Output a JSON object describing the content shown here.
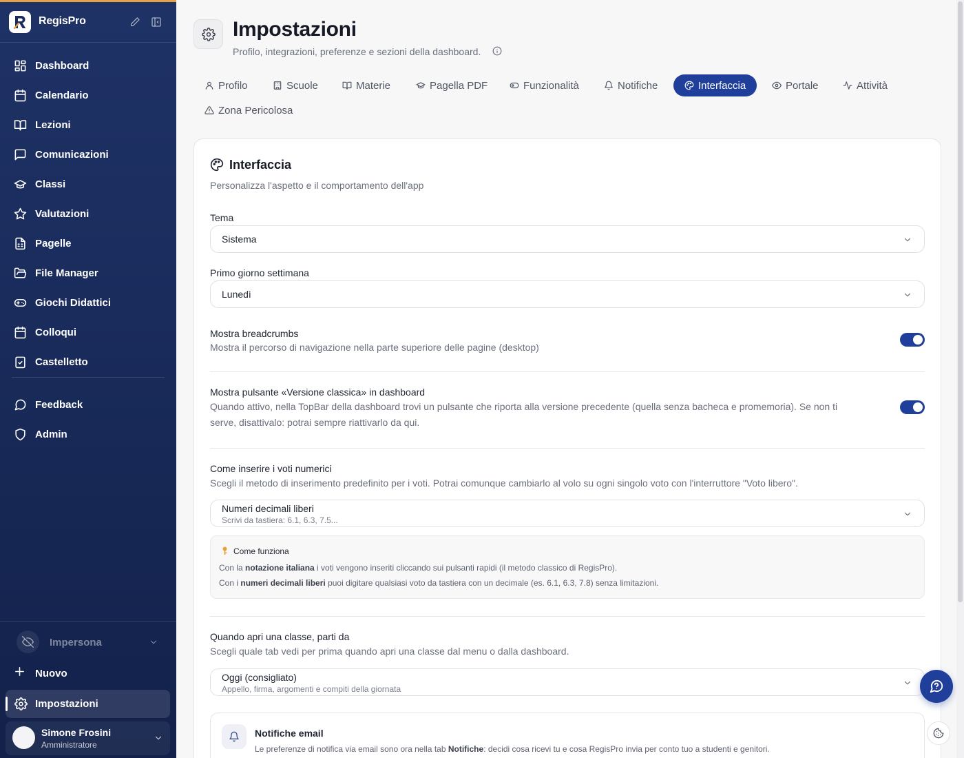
{
  "sidebar": {
    "brand": {
      "name": "RegisPro",
      "logo_letter": "R"
    },
    "items": [
      {
        "label": "Dashboard",
        "icon": "dashboard-grid-icon"
      },
      {
        "label": "Calendario",
        "icon": "calendar-icon"
      },
      {
        "label": "Lezioni",
        "icon": "book-open-icon"
      },
      {
        "label": "Comunicazioni",
        "icon": "message-square-icon"
      },
      {
        "label": "Classi",
        "icon": "graduation-cap-icon"
      },
      {
        "label": "Valutazioni",
        "icon": "star-icon"
      },
      {
        "label": "Pagelle",
        "icon": "report-card-icon"
      },
      {
        "label": "File Manager",
        "icon": "folder-icon"
      },
      {
        "label": "Giochi Didattici",
        "icon": "gamepad-icon"
      },
      {
        "label": "Colloqui",
        "icon": "calendar-check-icon"
      },
      {
        "label": "Castelletto",
        "icon": "clipboard-check-icon"
      }
    ],
    "secondary_items": [
      {
        "label": "Feedback",
        "icon": "message-circle-icon"
      },
      {
        "label": "Admin",
        "icon": "shield-icon"
      }
    ],
    "impersona_label": "Impersona",
    "nuovo_label": "Nuovo",
    "settings_label": "Impostazioni",
    "user": {
      "name": "Simone Frosini",
      "role": "Amministratore"
    }
  },
  "header": {
    "title": "Impostazioni",
    "subtitle": "Profilo, integrazioni, preferenze e sezioni della dashboard."
  },
  "tabs": [
    {
      "label": "Profilo",
      "active": false
    },
    {
      "label": "Scuole",
      "active": false
    },
    {
      "label": "Materie",
      "active": false
    },
    {
      "label": "Pagella PDF",
      "active": false
    },
    {
      "label": "Funzionalità",
      "active": false
    },
    {
      "label": "Notifiche",
      "active": false
    },
    {
      "label": "Interfaccia",
      "active": true
    },
    {
      "label": "Portale",
      "active": false
    },
    {
      "label": "Attività",
      "active": false
    },
    {
      "label": "Zona Pericolosa",
      "active": false
    }
  ],
  "interfaccia": {
    "title": "Interfaccia",
    "subtitle": "Personalizza l'aspetto e il comportamento dell'app",
    "tema": {
      "label": "Tema",
      "value": "Sistema"
    },
    "primo_giorno": {
      "label": "Primo giorno settimana",
      "value": "Lunedì"
    },
    "breadcrumbs": {
      "title": "Mostra breadcrumbs",
      "desc": "Mostra il percorso di navigazione nella parte superiore delle pagine (desktop)",
      "enabled": true
    },
    "versione_classica": {
      "title": "Mostra pulsante «Versione classica» in dashboard",
      "desc_line1": "Quando attivo, nella TopBar della dashboard trovi un pulsante che riporta alla versione precedente (quella senza bacheca e promemoria). Se non ti",
      "desc_line2": "serve, disattivalo: potrai sempre riattivarlo da qui.",
      "enabled": true
    },
    "voti": {
      "title": "Come inserire i voti numerici",
      "desc": "Scegli il metodo di inserimento predefinito per i voti. Potrai comunque cambiarlo al volo su ogni singolo voto con l'interruttore \"Voto libero\".",
      "value": "Numeri decimali liberi",
      "hint": "Scrivi da tastiera: 6.1, 6.3, 7.5..."
    },
    "come_funziona": {
      "title": "Come funziona",
      "line1_pre": "Con la ",
      "line1_bold": "notazione italiana",
      "line1_post": " i voti vengono inseriti cliccando sui pulsanti rapidi (il metodo classico di RegisPro).",
      "line2_pre": "Con i ",
      "line2_bold": "numeri decimali liberi",
      "line2_post": " puoi digitare qualsiasi voto da tastiera con un decimale (es. 6.1, 6.3, 7.8) senza limitazioni."
    },
    "apertura_classe": {
      "title": "Quando apri una classe, parti da",
      "desc": "Scegli quale tab vedi per prima quando apri una classe dal menu o dalla dashboard.",
      "value": "Oggi (consigliato)",
      "hint": "Appello, firma, argomenti e compiti della giornata"
    },
    "notifiche_email": {
      "title": "Notifiche email",
      "desc_pre": "Le preferenze di notifica via email sono ora nella tab ",
      "desc_bold": "Notifiche",
      "desc_post": ": decidi cosa ricevi tu e cosa RegisPro invia per conto tuo a studenti e genitori."
    }
  },
  "colors": {
    "sidebar_bg": "#1a2c5c",
    "accent": "#1f3f9a",
    "top_stripe": "#e2a24a"
  }
}
